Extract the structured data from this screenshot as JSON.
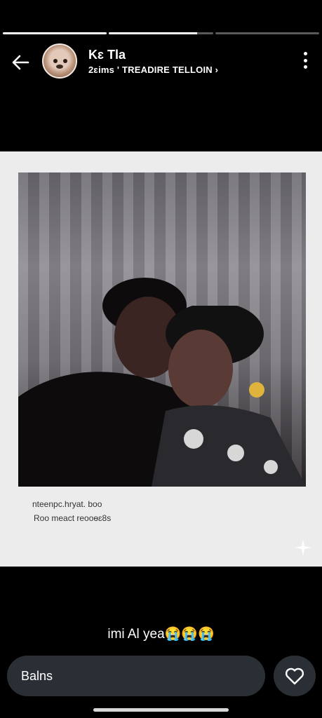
{
  "story": {
    "progress": [
      1.0,
      0.85,
      0.0
    ],
    "user_name": "Kɛ Tla",
    "subtitle": "2ɛims ' TREADIRE TELLOIN ›"
  },
  "post": {
    "caption_line1": "nteenpc.hryat. boo",
    "caption_line2": "Roo meact reooɵɛ8s"
  },
  "reply": {
    "message": "imi Al yea😭😭😭",
    "input_placeholder": "Balns"
  },
  "colors": {
    "background": "#000000",
    "card": "#ececec",
    "input_bg": "#2a2f35"
  },
  "icons": [
    "back-arrow-icon",
    "more-options-icon",
    "heart-icon",
    "sparkle-icon"
  ]
}
